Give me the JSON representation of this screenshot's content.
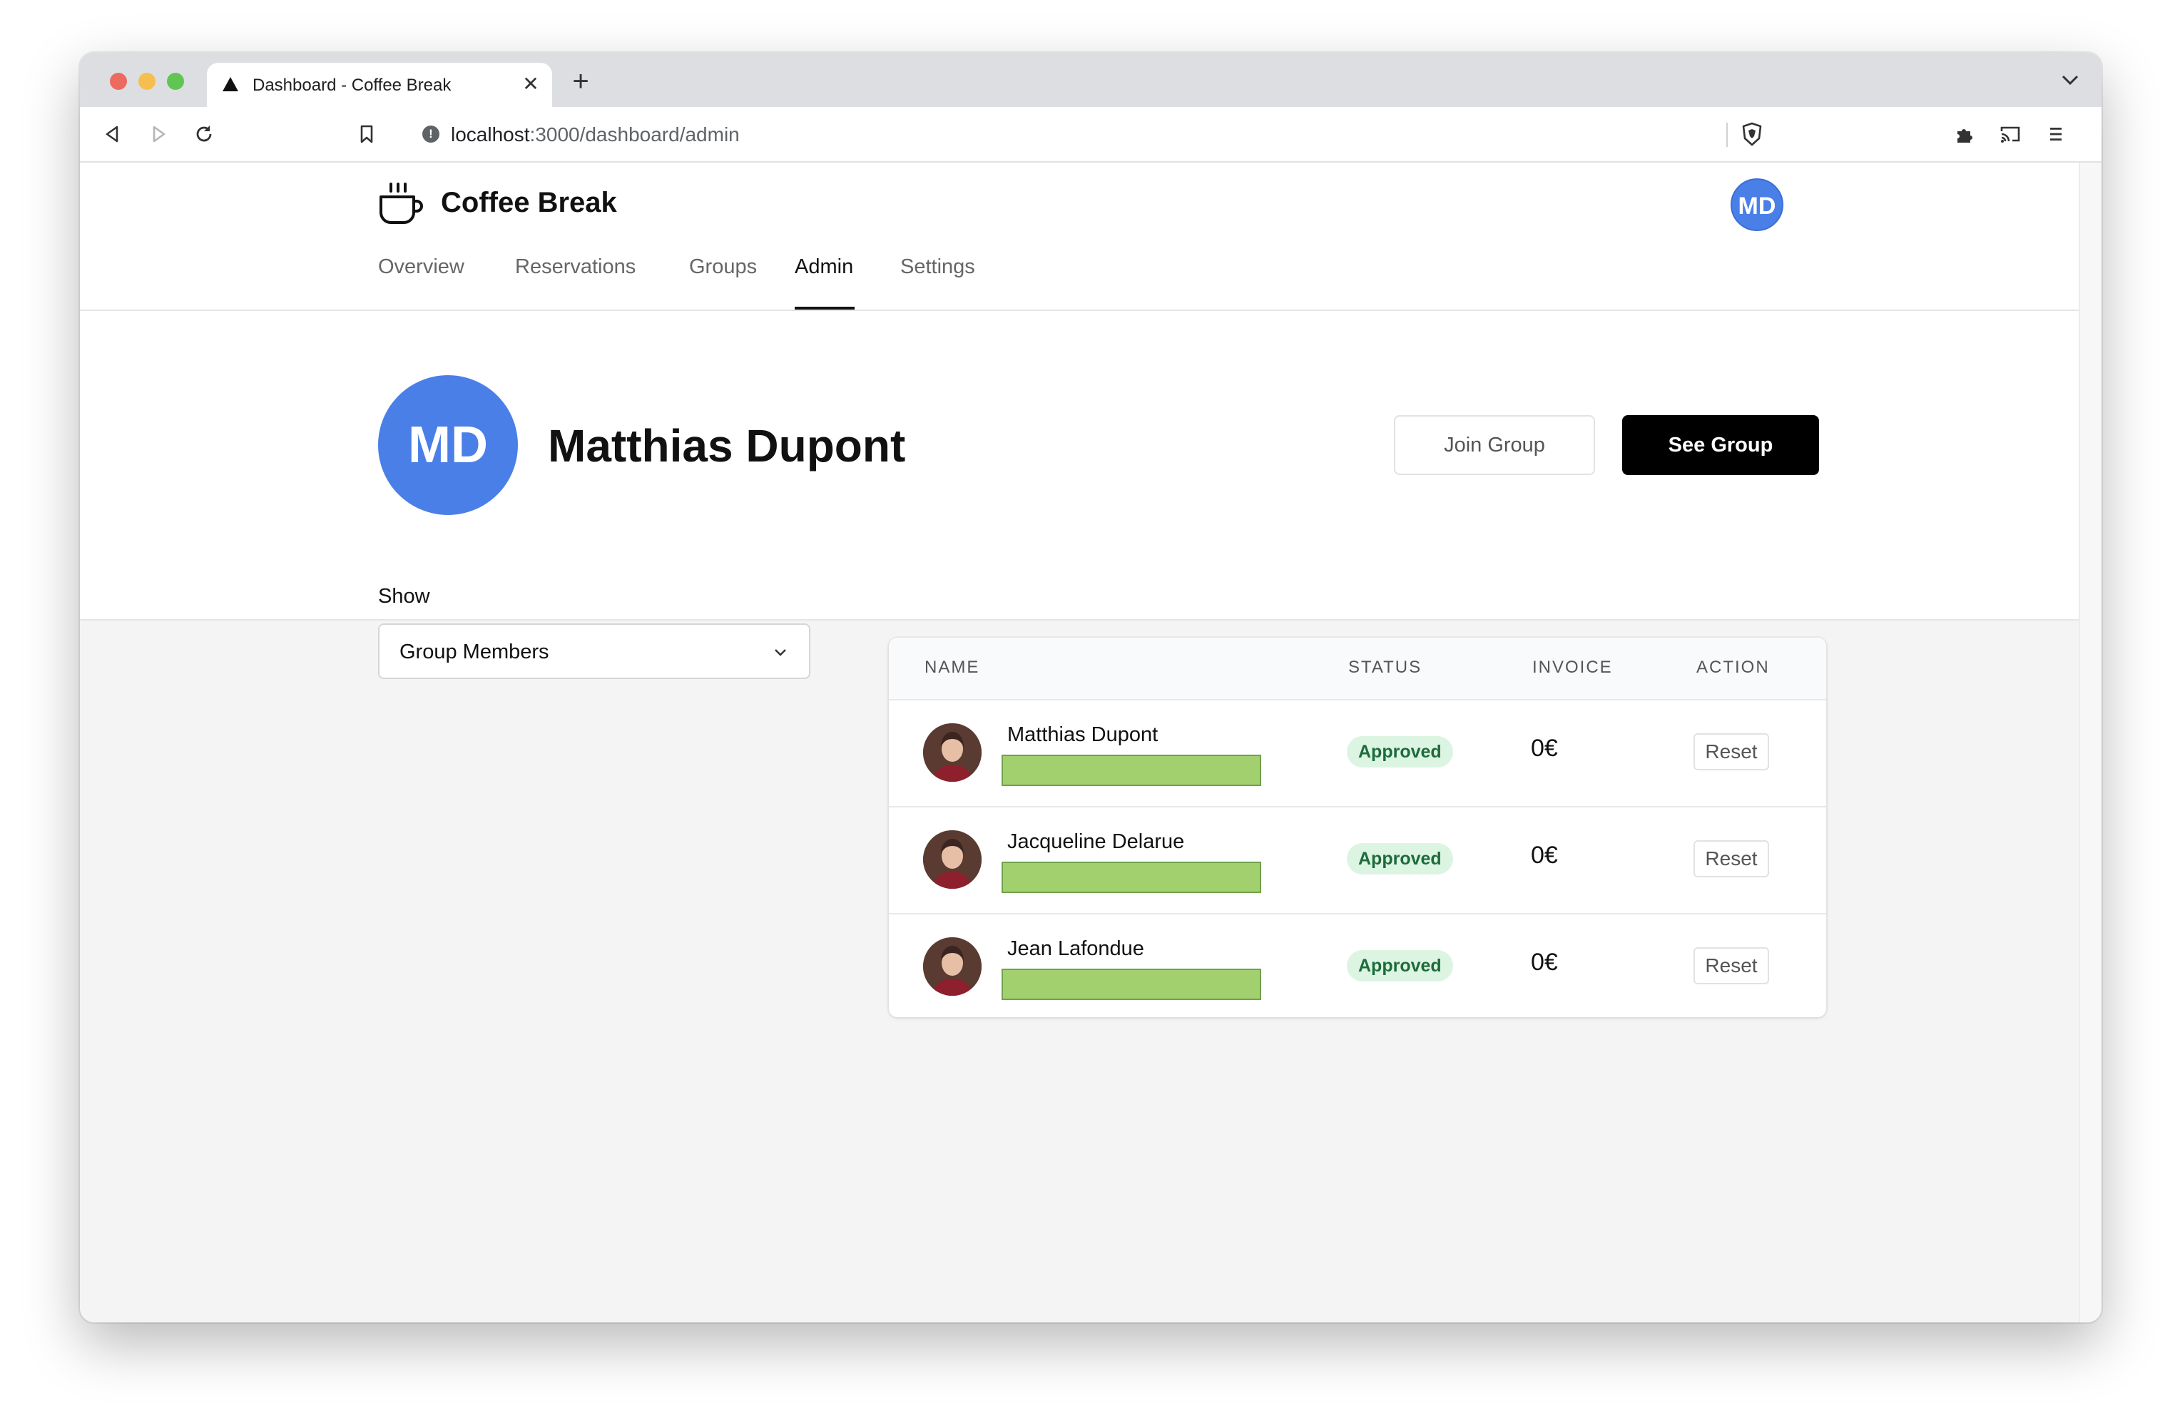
{
  "browser": {
    "tab_title": "Dashboard - Coffee Break",
    "tab_close": "✕",
    "new_tab": "+",
    "url_host": "localhost",
    "url_path": ":3000/dashboard/admin"
  },
  "app": {
    "brand": "Coffee Break",
    "user_initials": "MD",
    "nav": [
      {
        "label": "Overview",
        "active": false
      },
      {
        "label": "Reservations",
        "active": false
      },
      {
        "label": "Groups",
        "active": false
      },
      {
        "label": "Admin",
        "active": true
      },
      {
        "label": "Settings",
        "active": false
      }
    ]
  },
  "profile": {
    "initials": "MD",
    "name": "Matthias Dupont",
    "join_button": "Join Group",
    "see_button": "See Group"
  },
  "filter": {
    "label": "Show",
    "selected": "Group Members"
  },
  "table": {
    "headers": {
      "name": "NAME",
      "status": "STATUS",
      "invoice": "INVOICE",
      "action": "ACTION"
    },
    "rows": [
      {
        "name": "Matthias Dupont",
        "status": "Approved",
        "invoice": "0€",
        "action": "Reset"
      },
      {
        "name": "Jacqueline Delarue",
        "status": "Approved",
        "invoice": "0€",
        "action": "Reset"
      },
      {
        "name": "Jean Lafondue",
        "status": "Approved",
        "invoice": "0€",
        "action": "Reset"
      }
    ]
  },
  "colors": {
    "accent_avatar": "#4a7fe8",
    "approved_bg": "#dcf5e3",
    "approved_text": "#1e6b3b",
    "name_bar": "#a3d06f",
    "primary_button": "#000000"
  }
}
